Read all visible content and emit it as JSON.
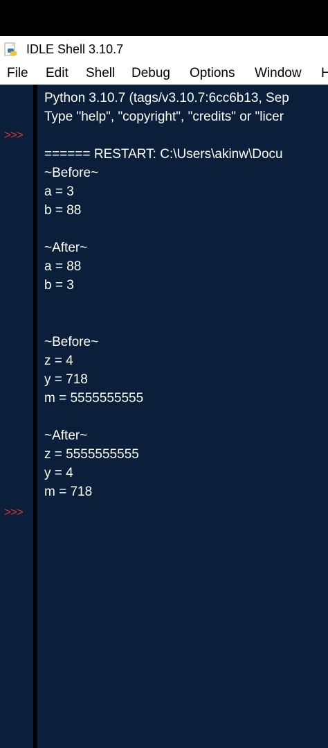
{
  "window": {
    "title": "IDLE Shell 3.10.7",
    "icon": "python-idle-icon"
  },
  "menu": {
    "items": [
      "File",
      "Edit",
      "Shell",
      "Debug",
      "Options",
      "Window",
      "H"
    ]
  },
  "shell": {
    "prompt_symbol": ">>>",
    "lines": [
      "Python 3.10.7 (tags/v3.10.7:6cc6b13, Sep",
      "Type \"help\", \"copyright\", \"credits\" or \"licer",
      "",
      "====== RESTART: C:\\Users\\akinw\\Docu",
      "~Before~",
      "a =  3",
      "b =  88",
      "",
      "~After~",
      "a =  88",
      "b =  3",
      "",
      "",
      "~Before~",
      "z =  4",
      "y =  718",
      "m =  5555555555",
      "",
      "~After~",
      "z =  5555555555",
      "y =  4",
      "m =  718"
    ]
  },
  "colors": {
    "shell_background": "#0b1f3a",
    "prompt": "#d9352b",
    "text": "#ffffff"
  }
}
